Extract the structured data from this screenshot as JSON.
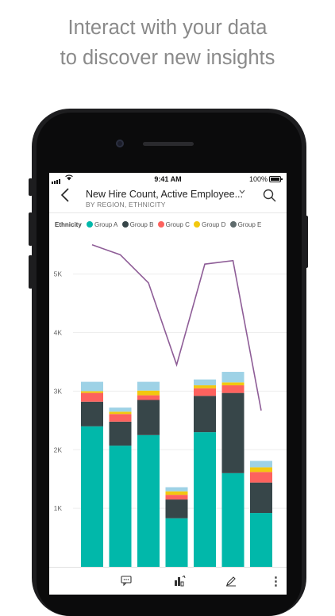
{
  "headline": {
    "line1": "Interact with your data",
    "line2": "to discover new insights"
  },
  "status_bar": {
    "time": "9:41 AM",
    "battery": "100%"
  },
  "nav": {
    "back_icon": "chevron-left-icon",
    "title": "New Hire Count, Active Employee...",
    "subtitle": "BY REGION, ETHNICITY",
    "dropdown_icon": "caret-down-icon",
    "search_icon": "search-icon"
  },
  "legend": {
    "title": "Ethnicity",
    "items": [
      {
        "label": "Group A",
        "color": "#01b8aa"
      },
      {
        "label": "Group B",
        "color": "#374649"
      },
      {
        "label": "Group C",
        "color": "#fd625e"
      },
      {
        "label": "Group D",
        "color": "#f2c80f"
      },
      {
        "label": "Group E",
        "color": "#5f6b6d"
      }
    ]
  },
  "chart_data": {
    "type": "bar",
    "stacked": true,
    "title": "New Hire Count, Active Employee...",
    "ylim": [
      0,
      5700
    ],
    "yticks": [
      "1K",
      "2K",
      "3K",
      "4K",
      "5K"
    ],
    "ytick_values": [
      1000,
      2000,
      3000,
      4000,
      5000
    ],
    "grid": true,
    "legend_position": "top-left",
    "series": [
      {
        "name": "Group A",
        "color": "#01b8aa",
        "values": [
          2400,
          2070,
          2250,
          830,
          2300,
          1600,
          920
        ]
      },
      {
        "name": "Group B",
        "color": "#374649",
        "values": [
          420,
          410,
          600,
          320,
          620,
          1370,
          520
        ]
      },
      {
        "name": "Group C",
        "color": "#fd625e",
        "values": [
          150,
          130,
          80,
          80,
          130,
          130,
          180
        ]
      },
      {
        "name": "Group D",
        "color": "#f2c80f",
        "values": [
          30,
          40,
          80,
          60,
          50,
          50,
          80
        ]
      },
      {
        "name": "Group E",
        "color": "#9ed2e6",
        "values": [
          160,
          70,
          150,
          70,
          100,
          180,
          110
        ]
      }
    ],
    "line": {
      "color": "#8e5d97",
      "values": [
        5500,
        5330,
        4850,
        3450,
        5170,
        5230,
        2670
      ]
    }
  },
  "toolbar": {
    "icons": [
      "comment-icon",
      "insights-icon",
      "annotate-icon",
      "more-icon"
    ],
    "more_glyph": "⋮"
  }
}
